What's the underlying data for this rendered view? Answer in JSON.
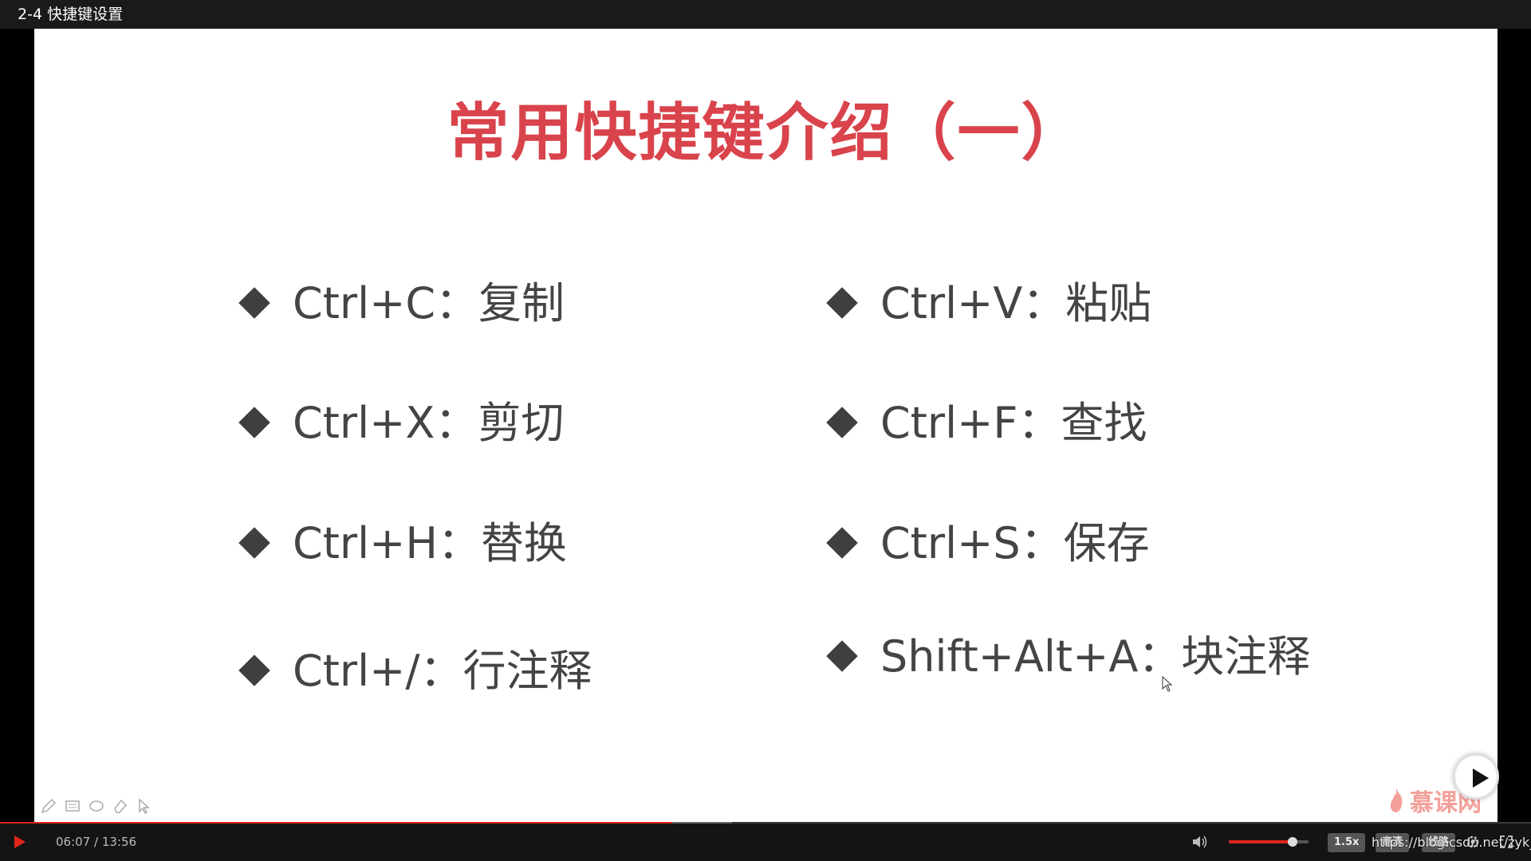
{
  "window": {
    "title": "2-4 快捷键设置"
  },
  "slide": {
    "title": "常用快捷键介绍（一）",
    "left_items": [
      "Ctrl+C：复制",
      "Ctrl+X：剪切",
      "Ctrl+H：替换",
      "Ctrl+/：行注释"
    ],
    "right_items": [
      "Ctrl+V：粘贴",
      "Ctrl+F：查找",
      "Ctrl+S：保存",
      "Shift+Alt+A：块注释"
    ],
    "title_color": "#d9434b"
  },
  "player": {
    "current_time": "06:07",
    "total_time": "13:56",
    "time_display": "06:07 / 13:56",
    "progress_fraction": 0.439,
    "buffer_fraction": 0.478,
    "volume_fraction": 0.8,
    "speed_label": "1.5x",
    "quality_label": "高清",
    "line_label": "线路",
    "accent_color": "#e1251b"
  },
  "watermark": {
    "logo_text": "慕课网",
    "url_text": "https://blog.csdn.net/zyk_ly"
  },
  "icons": {
    "play": "play-icon",
    "big_play": "big-play-icon",
    "volume": "volume-icon",
    "settings": "gear-icon",
    "fullscreen": "fullscreen-icon",
    "pen": "pen-icon",
    "rect": "rectangle-icon",
    "ellipse": "ellipse-icon",
    "eraser": "eraser-icon",
    "pointer": "pointer-icon"
  }
}
